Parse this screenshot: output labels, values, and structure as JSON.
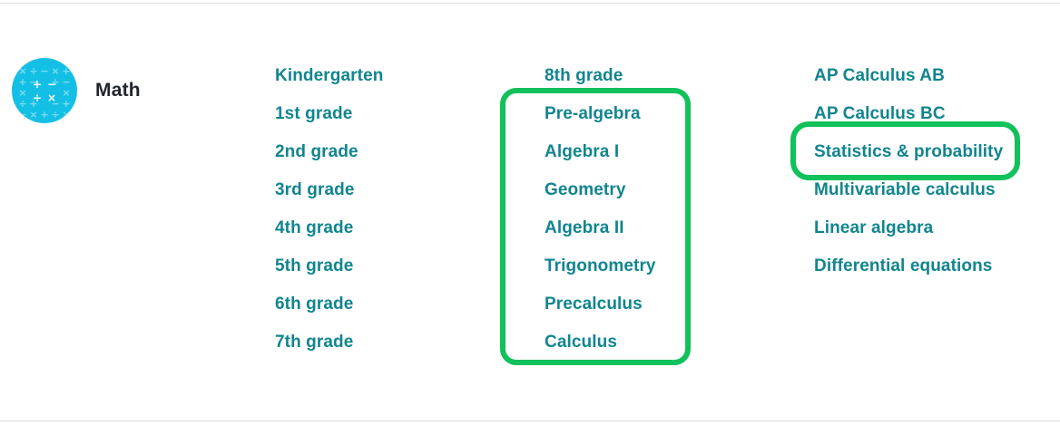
{
  "subject": {
    "title": "Math",
    "icon": "math-operators-icon",
    "icon_color": "#14bfe6"
  },
  "columns": [
    {
      "links": [
        "Kindergarten",
        "1st grade",
        "2nd grade",
        "3rd grade",
        "4th grade",
        "5th grade",
        "6th grade",
        "7th grade"
      ]
    },
    {
      "links": [
        "8th grade",
        "Pre-algebra",
        "Algebra I",
        "Geometry",
        "Algebra II",
        "Trigonometry",
        "Precalculus",
        "Calculus"
      ]
    },
    {
      "links": [
        "AP Calculus AB",
        "AP Calculus BC",
        "Statistics & probability",
        "Multivariable calculus",
        "Linear algebra",
        "Differential equations"
      ]
    }
  ],
  "colors": {
    "link": "#11858f",
    "title": "#21242c",
    "highlight": "#11c15b"
  }
}
